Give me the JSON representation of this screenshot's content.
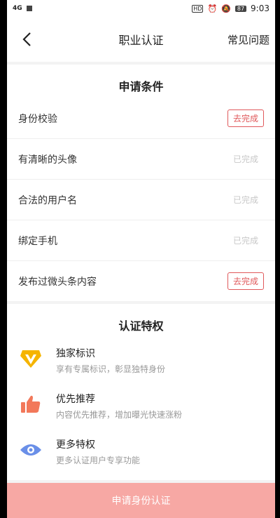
{
  "status": {
    "signal": "4G",
    "hd": "HD",
    "battery": "87",
    "time": "9:03"
  },
  "nav": {
    "title": "职业认证",
    "faq": "常见问题"
  },
  "conditions": {
    "title": "申请条件",
    "items": [
      {
        "label": "身份校验",
        "status": "去完成",
        "done": false
      },
      {
        "label": "有清晰的头像",
        "status": "已完成",
        "done": true
      },
      {
        "label": "合法的用户名",
        "status": "已完成",
        "done": true
      },
      {
        "label": "绑定手机",
        "status": "已完成",
        "done": true
      },
      {
        "label": "发布过微头条内容",
        "status": "去完成",
        "done": false
      }
    ]
  },
  "privileges": {
    "title": "认证特权",
    "items": [
      {
        "title": "独家标识",
        "desc": "享有专属标识，彰显独特身份",
        "icon": "v-badge-icon"
      },
      {
        "title": "优先推荐",
        "desc": "内容优先推荐，增加曝光快速涨粉",
        "icon": "thumbs-up-icon"
      },
      {
        "title": "更多特权",
        "desc": "更多认证用户专享功能",
        "icon": "eye-icon"
      }
    ]
  },
  "footer": {
    "button": "申请身份认证"
  },
  "colors": {
    "accent": "#e0585a",
    "footer": "#f7a8a4",
    "badge": "#f5b400",
    "thumb": "#f2785a",
    "eye": "#6a8fe8"
  }
}
